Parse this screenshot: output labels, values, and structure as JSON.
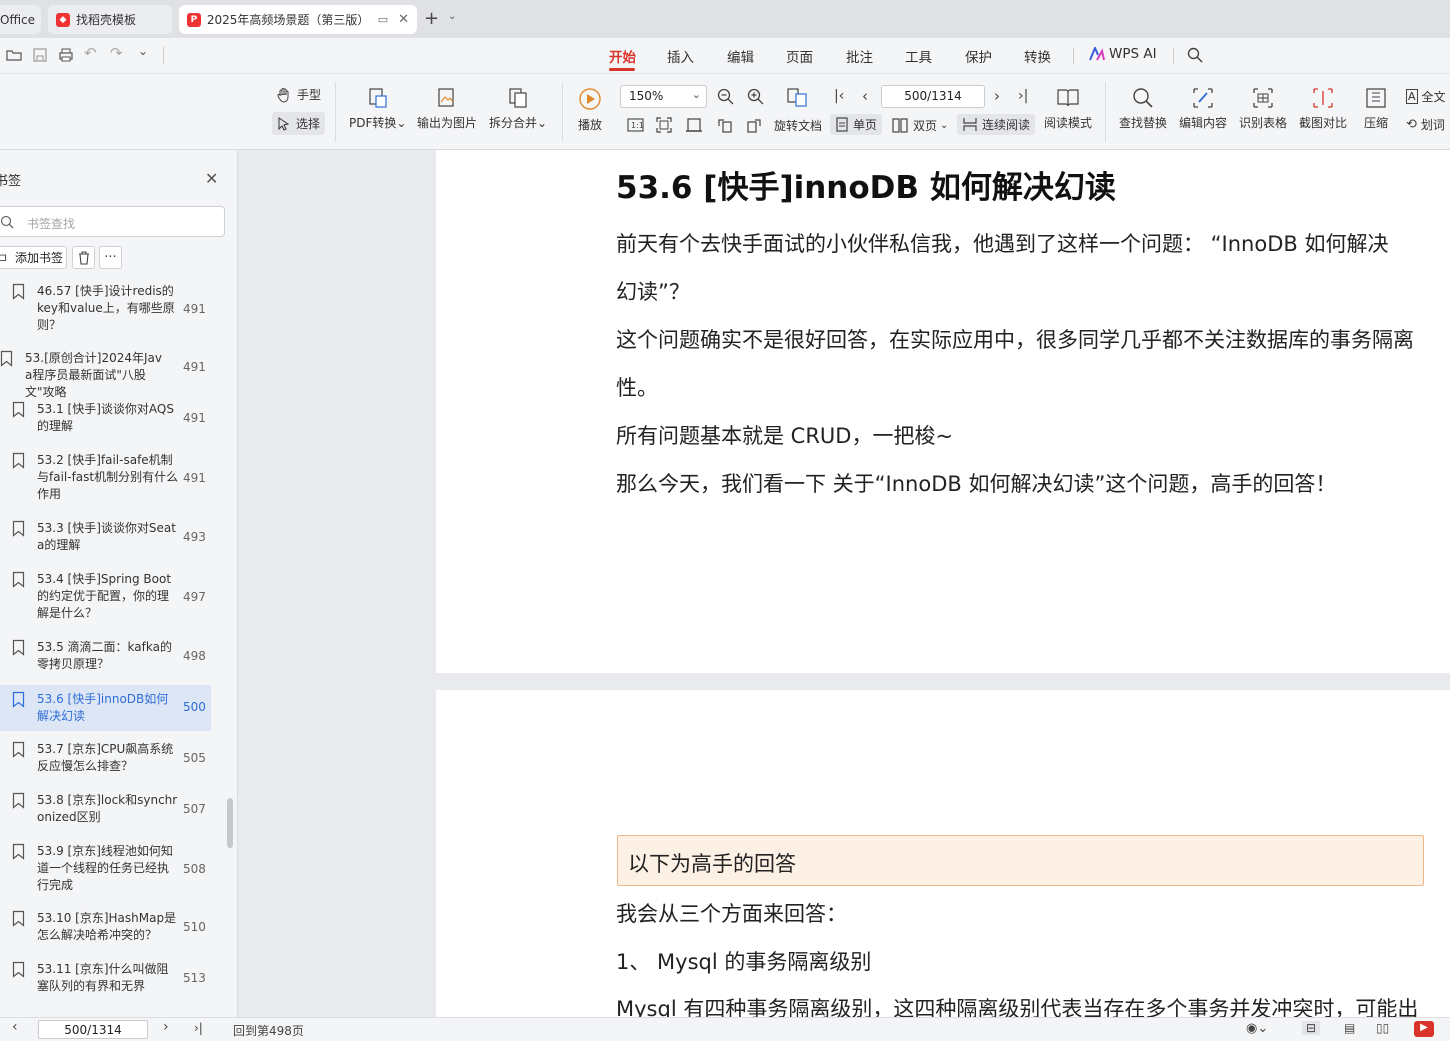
{
  "tabs": [
    {
      "label": "Office"
    },
    {
      "label": "找稻壳模板"
    },
    {
      "label": "2025年高频场景题（第三版）"
    }
  ],
  "menu": [
    "开始",
    "插入",
    "编辑",
    "页面",
    "批注",
    "工具",
    "保护",
    "转换",
    "WPS AI"
  ],
  "ribbon": {
    "hand": "手型",
    "select": "选择",
    "pdf_convert": "PDF转换",
    "export_image": "输出为图片",
    "split_merge": "拆分合并",
    "play": "播放",
    "zoom": "150%",
    "page": "500/1314",
    "rotate": "旋转文档",
    "single": "单页",
    "double": "双页",
    "continuous": "连续阅读",
    "read_mode": "阅读模式",
    "find_replace": "查找替换",
    "edit_content": "编辑内容",
    "detect_table": "识别表格",
    "screenshot_compare": "截图对比",
    "compress": "压缩",
    "full_text": "全文",
    "mark": "划词"
  },
  "sidebar": {
    "title": "书签",
    "search_placeholder": "书签查找",
    "add_bookmark": "添加书签",
    "more": "···",
    "items": [
      {
        "text": "46.57 [快手]设计redis的key和value上，有哪些原则？",
        "page": "491"
      },
      {
        "text": "53.[原创合计]2024年Java程序员最新面试\"八股文\"攻略",
        "page": "491"
      },
      {
        "text": "53.1 [快手]谈谈你对AQS的理解",
        "page": "491"
      },
      {
        "text": "53.2 [快手]fail-safe机制与fail-fast机制分别有什么作用",
        "page": "491"
      },
      {
        "text": "53.3 [快手]谈谈你对Seata的理解",
        "page": "493"
      },
      {
        "text": "53.4 [快手]Spring Boot的约定优于配置，你的理解是什么？",
        "page": "497"
      },
      {
        "text": "53.5 滴滴二面：kafka的零拷贝原理？",
        "page": "498"
      },
      {
        "text": "53.6 [快手]innoDB如何解决幻读",
        "page": "500"
      },
      {
        "text": "53.7 [京东]CPU飙高系统反应慢怎么排查？",
        "page": "505"
      },
      {
        "text": "53.8 [京东]lock和synchronized区别",
        "page": "507"
      },
      {
        "text": "53.9 [京东]线程池如何知道一个线程的任务已经执行完成",
        "page": "508"
      },
      {
        "text": "53.10 [京东]HashMap是怎么解决哈希冲突的？",
        "page": "510"
      },
      {
        "text": "53.11 [京东]什么叫做阻塞队列的有界和无界",
        "page": "513"
      }
    ]
  },
  "document": {
    "heading": "53.6 [快手]innoDB 如何解决幻读",
    "p1a": "前天有个去快手面试的小伙伴私信我，他遇到了这样一个问题：  “InnoDB 如何解决",
    "p1b": "幻读”？",
    "p2a": "这个问题确实不是很好回答，在实际应用中，很多同学几乎都不关注数据库的事务隔离",
    "p2b": "性。",
    "p3": "所有问题基本就是 CRUD，一把梭~",
    "p4": "那么今天，我们看一下  关于“InnoDB 如何解决幻读”这个问题，高手的回答！",
    "callout": "以下为高手的回答",
    "p5": "我会从三个方面来回答：",
    "p6": "1、  Mysql 的事务隔离级别",
    "p7": "Mysql 有四种事务隔离级别，这四种隔离级别代表当存在多个事务并发冲突时，可能出"
  },
  "status": {
    "page": "500/1314",
    "back": "回到第498页"
  },
  "colors": {
    "accent": "#d9342b",
    "selected": "#2f6ed8"
  }
}
